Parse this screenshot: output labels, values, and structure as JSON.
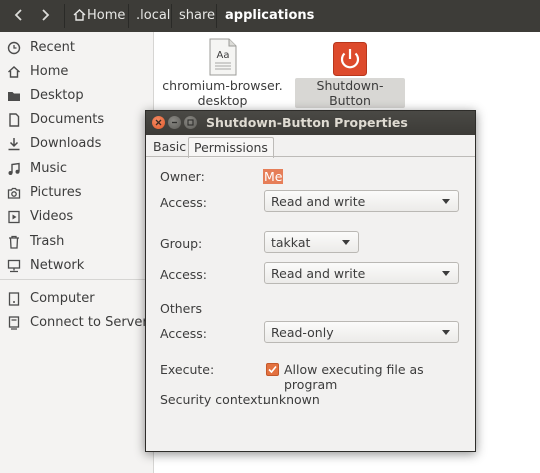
{
  "toolbar": {
    "breadcrumbs": [
      "Home",
      ".local",
      "share",
      "applications"
    ]
  },
  "sidebar": {
    "items": [
      {
        "label": "Recent",
        "icon": "clock-icon"
      },
      {
        "label": "Home",
        "icon": "home-icon"
      },
      {
        "label": "Desktop",
        "icon": "folder-icon"
      },
      {
        "label": "Documents",
        "icon": "document-icon"
      },
      {
        "label": "Downloads",
        "icon": "download-icon"
      },
      {
        "label": "Music",
        "icon": "music-icon"
      },
      {
        "label": "Pictures",
        "icon": "camera-icon"
      },
      {
        "label": "Videos",
        "icon": "video-icon"
      },
      {
        "label": "Trash",
        "icon": "trash-icon"
      },
      {
        "label": "Network",
        "icon": "network-icon"
      },
      {
        "label": "Computer",
        "icon": "computer-icon"
      },
      {
        "label": "Connect to Server",
        "icon": "server-icon"
      }
    ]
  },
  "files": [
    {
      "name_line1": "chromium-browser.",
      "name_line2": "desktop",
      "icon": "text-file-icon"
    },
    {
      "name_line1": "Shutdown-Button",
      "icon": "power-icon"
    }
  ],
  "dialog": {
    "title": "Shutdown-Button Properties",
    "tabs": [
      "Basic",
      "Permissions"
    ],
    "active_tab": "Permissions",
    "owner_label": "Owner:",
    "owner_value": "Me",
    "owner_access_label": "Access:",
    "owner_access_value": "Read and write",
    "group_label": "Group:",
    "group_value": "takkat",
    "group_access_label": "Access:",
    "group_access_value": "Read and write",
    "others_label": "Others",
    "others_access_label": "Access:",
    "others_access_value": "Read-only",
    "execute_label": "Execute:",
    "execute_checkbox_label": "Allow executing file as program",
    "execute_checked": true,
    "security_label": "Security context:",
    "security_value": "unknown"
  },
  "colors": {
    "accent": "#e95420",
    "toolbar_bg": "#3d3c38",
    "checkbox": "#e3713f"
  }
}
